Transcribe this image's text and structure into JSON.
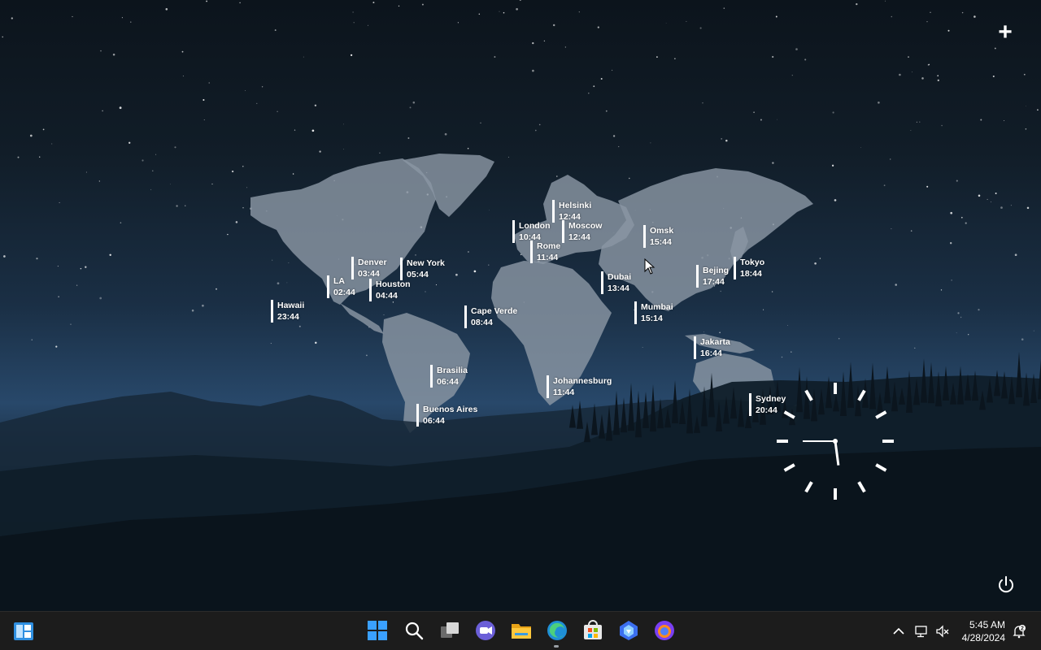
{
  "cities": [
    {
      "name": "Helsinki",
      "time": "12:44"
    },
    {
      "name": "London",
      "time": "10:44"
    },
    {
      "name": "Moscow",
      "time": "12:44"
    },
    {
      "name": "Omsk",
      "time": "15:44"
    },
    {
      "name": "Rome",
      "time": "11:44"
    },
    {
      "name": "Denver",
      "time": "03:44"
    },
    {
      "name": "New York",
      "time": "05:44"
    },
    {
      "name": "LA",
      "time": "02:44"
    },
    {
      "name": "Houston",
      "time": "04:44"
    },
    {
      "name": "Hawaii",
      "time": "23:44"
    },
    {
      "name": "Cape Verde",
      "time": "08:44"
    },
    {
      "name": "Dubai",
      "time": "13:44"
    },
    {
      "name": "Bejing",
      "time": "17:44"
    },
    {
      "name": "Tokyo",
      "time": "18:44"
    },
    {
      "name": "Mumbai",
      "time": "15:14"
    },
    {
      "name": "Jakarta",
      "time": "16:44"
    },
    {
      "name": "Brasilia",
      "time": "06:44"
    },
    {
      "name": "Johannesburg",
      "time": "11:44"
    },
    {
      "name": "Buenos Aires",
      "time": "06:44"
    },
    {
      "name": "Sydney",
      "time": "20:44"
    }
  ],
  "clock": {
    "hour": 5,
    "minute": 45
  },
  "controls": {
    "add_symbol": "+"
  },
  "taskbar": {
    "icons": [
      "start-icon",
      "search-icon",
      "task-view-icon",
      "chat-icon",
      "file-explorer-icon",
      "edge-icon",
      "store-icon",
      "copilot-icon",
      "firefox-icon"
    ],
    "time": "5:45 AM",
    "date": "4/28/2024",
    "notification_count": "2"
  },
  "colors": {
    "taskbar_bg": "#1c1c1c",
    "map_land": "#8a96a3",
    "text": "#ffffff"
  }
}
